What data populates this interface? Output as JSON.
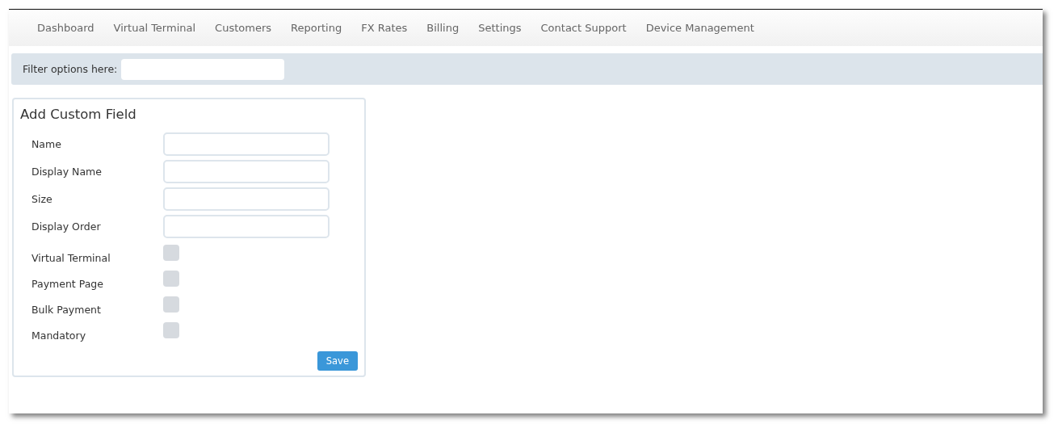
{
  "nav": [
    "Dashboard",
    "Virtual Terminal",
    "Customers",
    "Reporting",
    "FX Rates",
    "Billing",
    "Settings",
    "Contact Support",
    "Device Management"
  ],
  "filter": {
    "label": "Filter options here:"
  },
  "form": {
    "title": "Add Custom Field",
    "fields": [
      {
        "label": "Name",
        "kind": "text"
      },
      {
        "label": "Display Name",
        "kind": "text"
      },
      {
        "label": "Size",
        "kind": "text"
      },
      {
        "label": "Display Order",
        "kind": "text"
      },
      {
        "label": "Virtual Terminal",
        "kind": "checkbox",
        "checked": false
      },
      {
        "label": "Payment Page",
        "kind": "checkbox",
        "checked": false
      },
      {
        "label": "Bulk Payment",
        "kind": "checkbox",
        "checked": false
      },
      {
        "label": "Mandatory",
        "kind": "checkbox",
        "checked": false
      }
    ],
    "button": "Save"
  }
}
